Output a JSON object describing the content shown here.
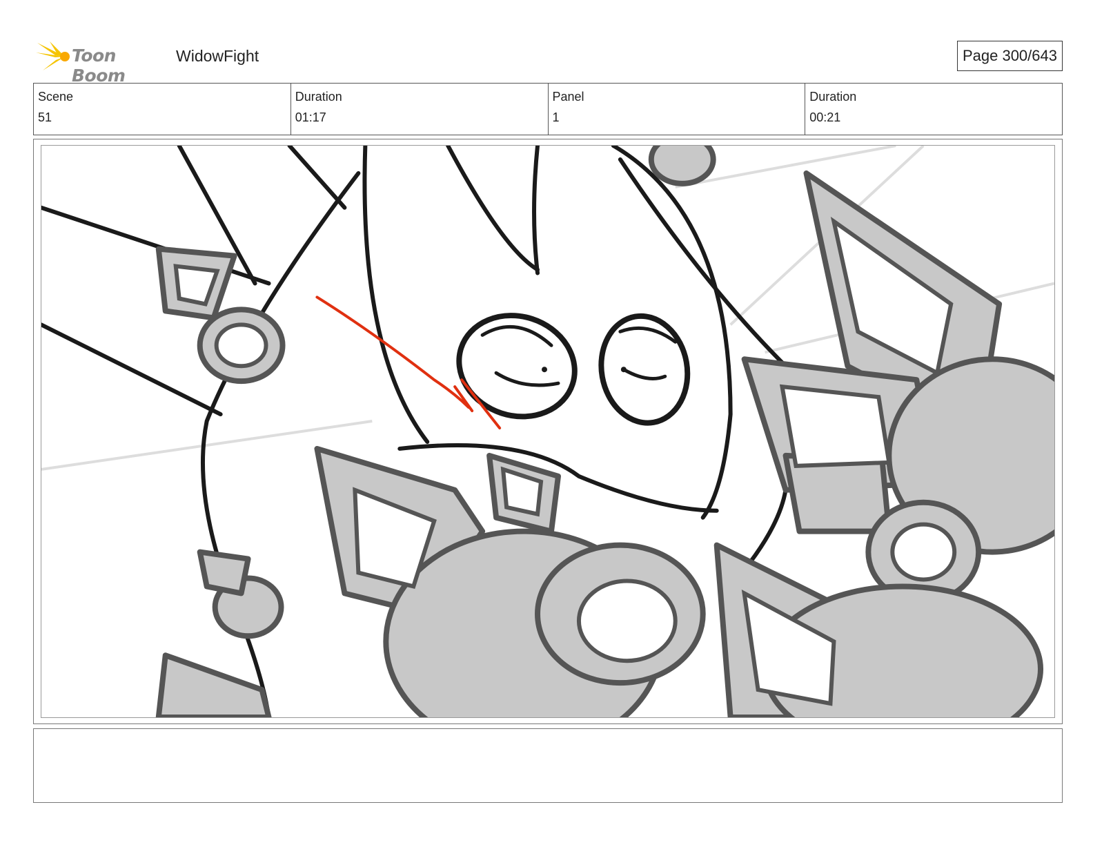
{
  "header": {
    "logo_text": "Toon Boom",
    "project_title": "WidowFight",
    "page_label": "Page 300/643"
  },
  "info": {
    "scene_label": "Scene",
    "scene_value": "51",
    "scene_duration_label": "Duration",
    "scene_duration_value": "01:17",
    "panel_label": "Panel",
    "panel_value": "1",
    "panel_duration_label": "Duration",
    "panel_duration_value": "00:21"
  },
  "notes": {
    "text": ""
  },
  "colors": {
    "logo_yellow": "#f5c400",
    "sketch_gray": "#c8c8c8",
    "sketch_line": "#555555",
    "accent_red": "#e03010"
  }
}
